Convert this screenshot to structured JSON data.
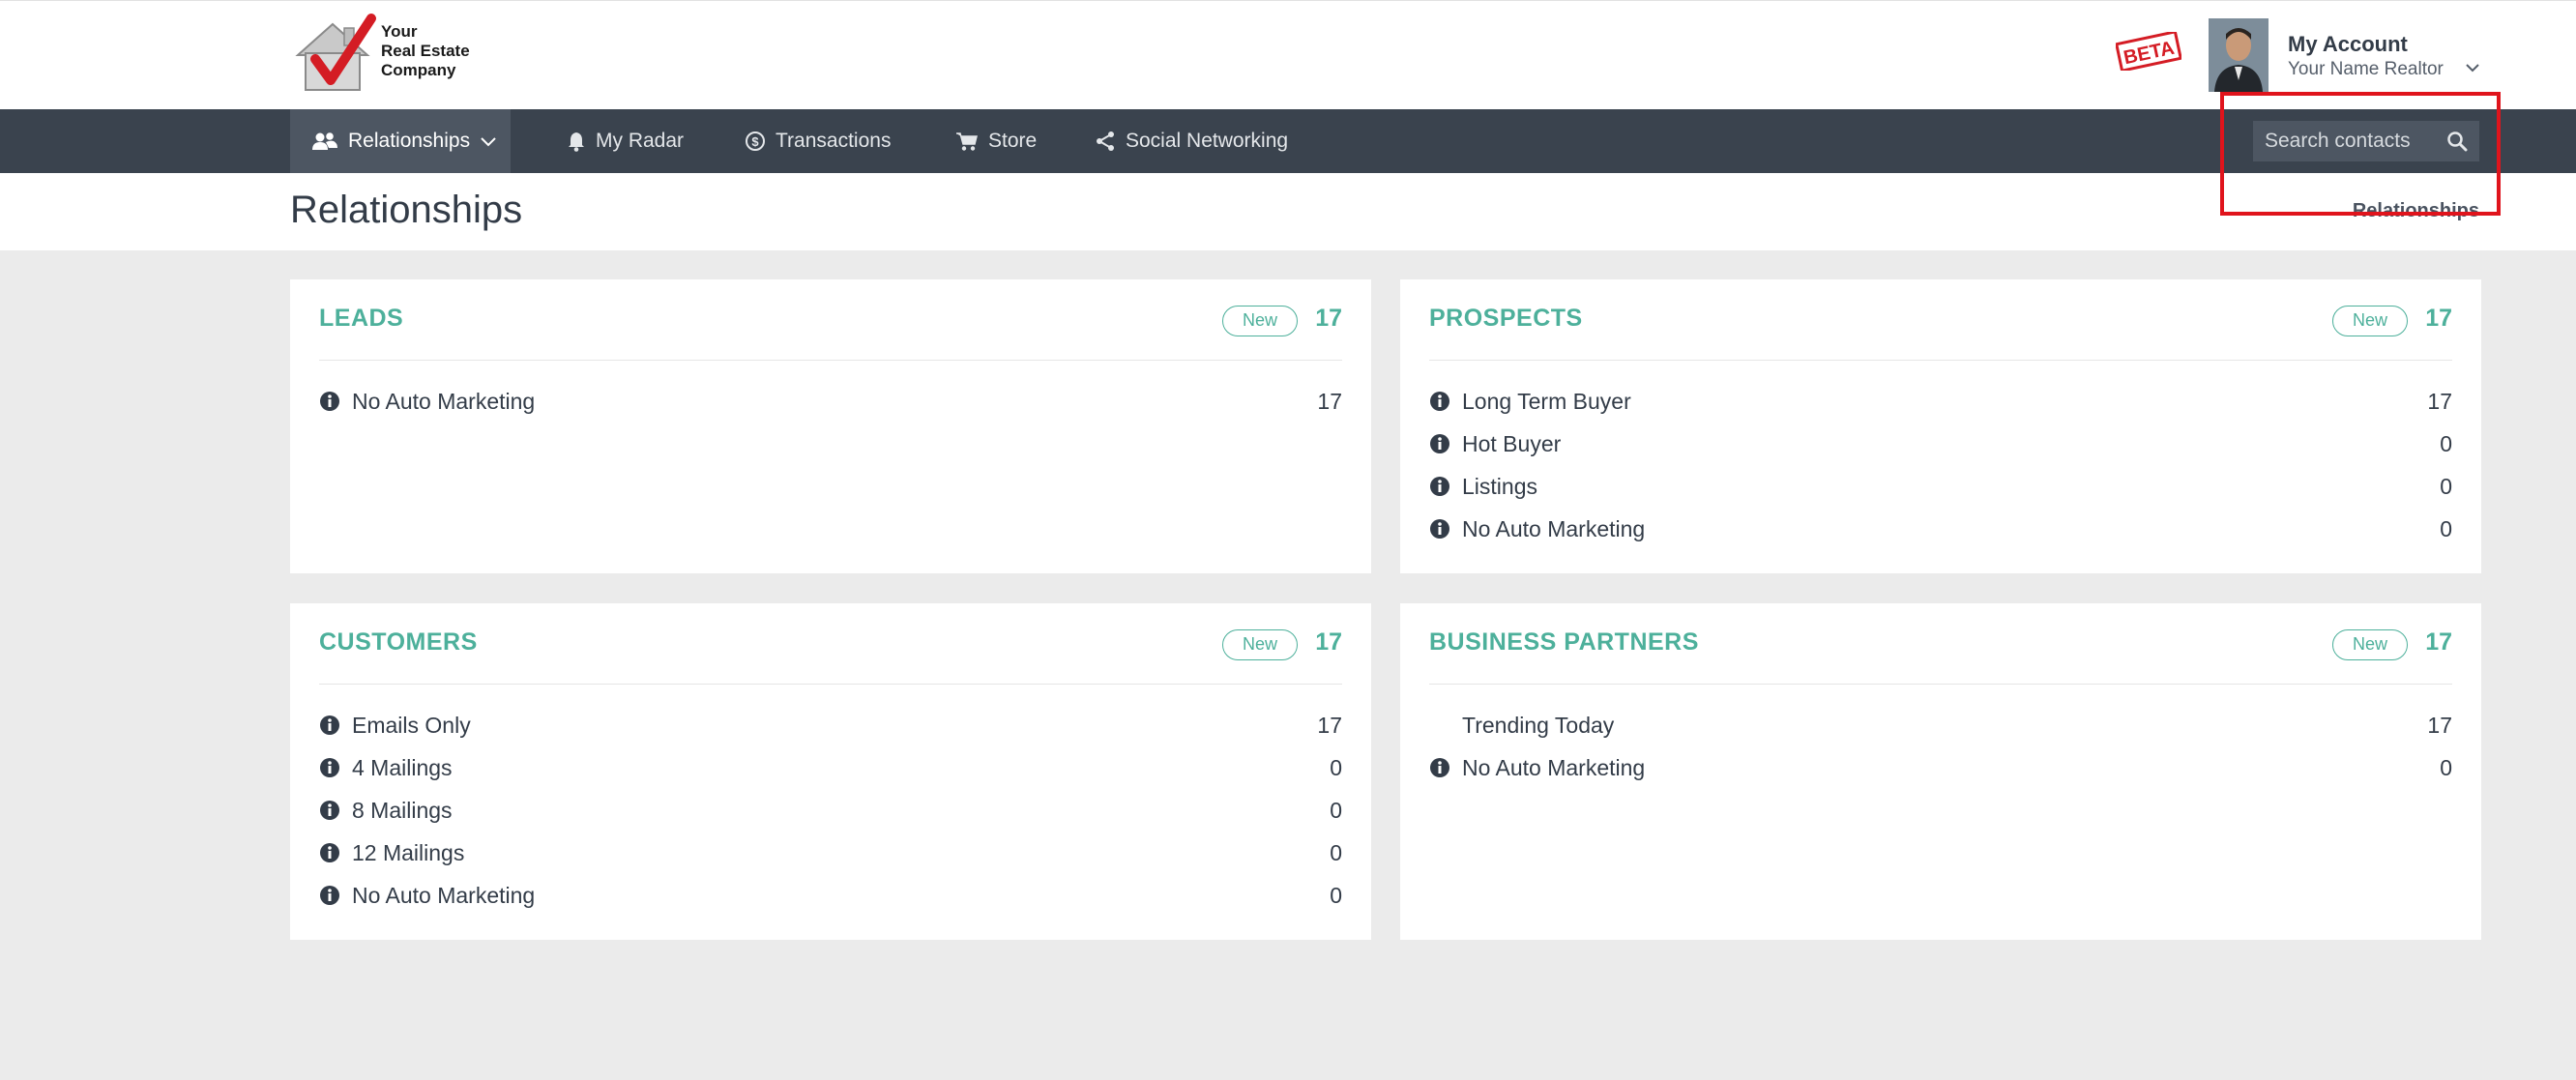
{
  "brand": {
    "logo_lines": [
      "Your",
      "Real Estate",
      "Company"
    ],
    "beta_badge": "BETA"
  },
  "account": {
    "title": "My Account",
    "subtitle": "Your Name Realtor"
  },
  "nav": {
    "items": [
      {
        "label": "Relationships",
        "icon": "people-icon",
        "active": true
      },
      {
        "label": "My Radar",
        "icon": "bell-icon"
      },
      {
        "label": "Transactions",
        "icon": "dollar-circle-icon"
      },
      {
        "label": "Store",
        "icon": "cart-icon"
      },
      {
        "label": "Social Networking",
        "icon": "share-icon"
      }
    ],
    "search_placeholder": "Search contacts"
  },
  "page": {
    "title": "Relationships",
    "breadcrumb": "Relationships"
  },
  "colors": {
    "accent": "#4db09b",
    "nav_bg": "#3a434e",
    "highlight": "#e0141c"
  },
  "panels": [
    {
      "title": "LEADS",
      "badge": "New",
      "count": "17",
      "rows": [
        {
          "label": "No Auto Marketing",
          "count": "17",
          "info": true
        }
      ]
    },
    {
      "title": "PROSPECTS",
      "badge": "New",
      "count": "17",
      "rows": [
        {
          "label": "Long Term Buyer",
          "count": "17",
          "info": true
        },
        {
          "label": "Hot Buyer",
          "count": "0",
          "info": true
        },
        {
          "label": "Listings",
          "count": "0",
          "info": true
        },
        {
          "label": "No Auto Marketing",
          "count": "0",
          "info": true
        }
      ]
    },
    {
      "title": "CUSTOMERS",
      "badge": "New",
      "count": "17",
      "rows": [
        {
          "label": "Emails Only",
          "count": "17",
          "info": true
        },
        {
          "label": "4 Mailings",
          "count": "0",
          "info": true
        },
        {
          "label": "8 Mailings",
          "count": "0",
          "info": true
        },
        {
          "label": "12 Mailings",
          "count": "0",
          "info": true
        },
        {
          "label": "No Auto Marketing",
          "count": "0",
          "info": true
        }
      ]
    },
    {
      "title": "BUSINESS PARTNERS",
      "badge": "New",
      "count": "17",
      "rows": [
        {
          "label": "Trending Today",
          "count": "17",
          "info": false
        },
        {
          "label": "No Auto Marketing",
          "count": "0",
          "info": true
        }
      ]
    }
  ]
}
